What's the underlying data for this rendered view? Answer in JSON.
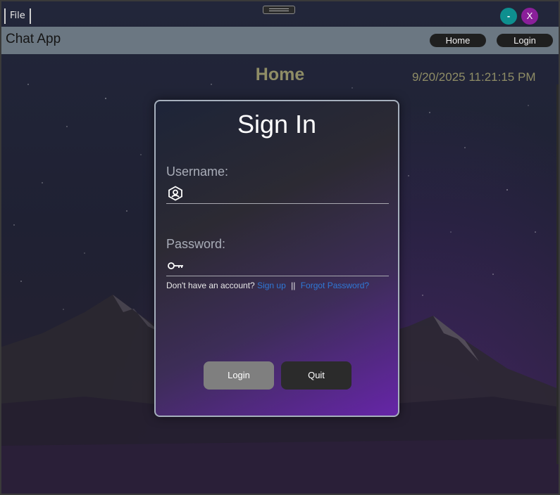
{
  "window": {
    "file_menu": "File",
    "minimize_label": "-",
    "close_label": "X"
  },
  "navbar": {
    "app_title": "Chat App",
    "home_label": "Home",
    "login_label": "Login"
  },
  "page": {
    "heading": "Home",
    "datetime": "9/20/2025 11:21:15 PM"
  },
  "signin": {
    "title": "Sign In",
    "username_label": "Username:",
    "username_value": "",
    "password_label": "Password:",
    "password_value": "",
    "no_account_text": "Don't have an account?",
    "signup_link": "Sign up",
    "separator": "||",
    "forgot_link": "Forgot Password?",
    "login_button": "Login",
    "quit_button": "Quit"
  },
  "colors": {
    "accent_gold": "#8f8d66",
    "minimize_teal": "#0e8f8f",
    "close_purple": "#8a1f9a",
    "link_blue": "#2f78d6",
    "navbar_gray": "#6b7782"
  },
  "icons": {
    "username": "user-badge-icon",
    "password": "key-icon"
  }
}
